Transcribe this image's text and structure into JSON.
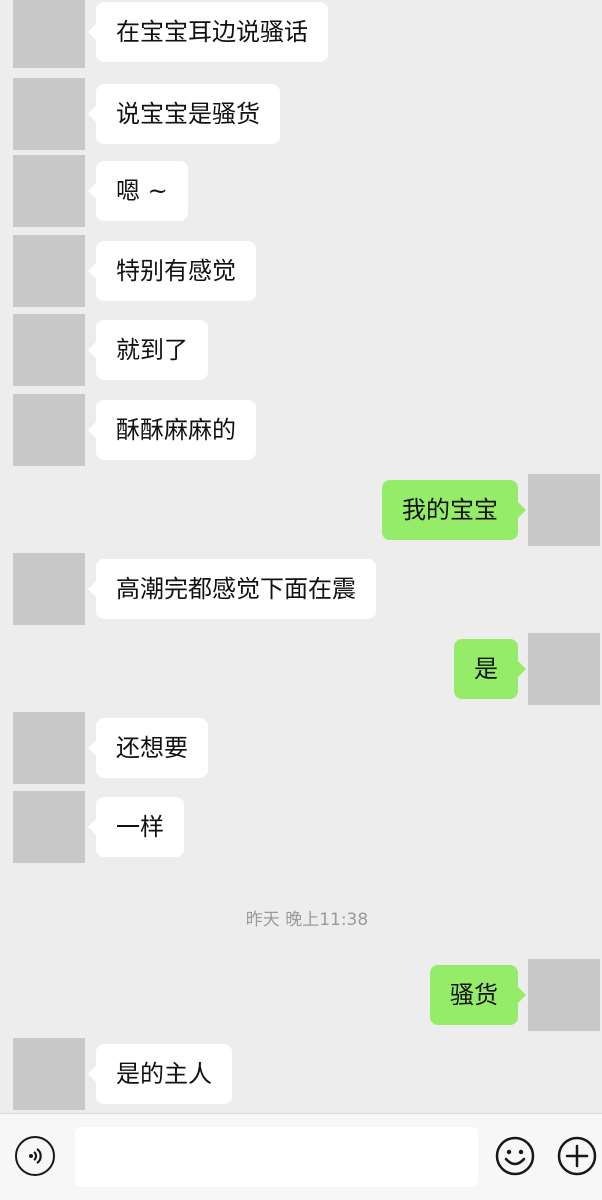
{
  "messages": [
    {
      "side": "incoming",
      "text": "在宝宝耳边说骚话"
    },
    {
      "side": "incoming",
      "text": "说宝宝是骚货"
    },
    {
      "side": "incoming",
      "text": "嗯 ~"
    },
    {
      "side": "incoming",
      "text": "特别有感觉"
    },
    {
      "side": "incoming",
      "text": "就到了"
    },
    {
      "side": "incoming",
      "text": "酥酥麻麻的"
    },
    {
      "side": "outgoing",
      "text": "我的宝宝"
    },
    {
      "side": "incoming",
      "text": "高潮完都感觉下面在震"
    },
    {
      "side": "outgoing",
      "text": "是"
    },
    {
      "side": "incoming",
      "text": "还想要"
    },
    {
      "side": "incoming",
      "text": "一样"
    },
    {
      "side": "outgoing",
      "text": "骚货"
    },
    {
      "side": "incoming",
      "text": "是的主人"
    }
  ],
  "timestamp": "昨天 晚上11:38",
  "input_bar": {
    "text_value": "",
    "voice_icon": "voice-icon",
    "emoji_icon": "emoji-icon",
    "plus_icon": "plus-icon"
  },
  "colors": {
    "background": "#ededed",
    "incoming_bubble": "#ffffff",
    "outgoing_bubble": "#95ec69",
    "avatar": "#c8c8c8"
  }
}
